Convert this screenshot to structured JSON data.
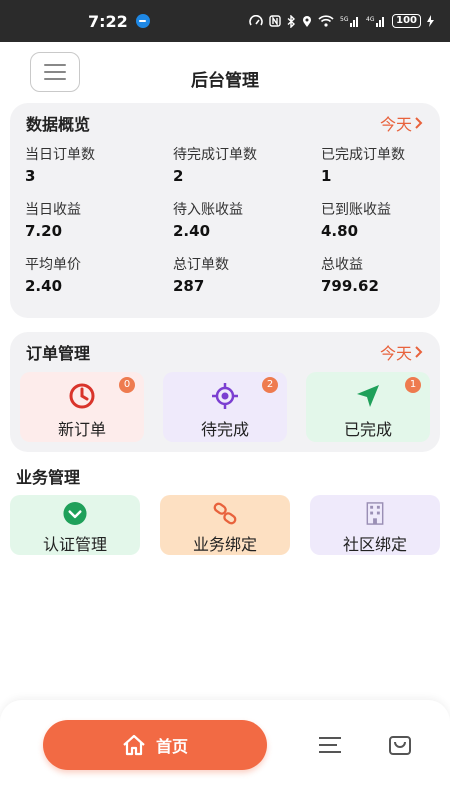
{
  "status_bar": {
    "time": "7:22",
    "battery": "100"
  },
  "header": {
    "title": "后台管理"
  },
  "overview": {
    "title": "数据概览",
    "filter_label": "今天",
    "stats": [
      {
        "label": "当日订单数",
        "value": "3"
      },
      {
        "label": "待完成订单数",
        "value": "2"
      },
      {
        "label": "已完成订单数",
        "value": "1"
      },
      {
        "label": "当日收益",
        "value": "7.20"
      },
      {
        "label": "待入账收益",
        "value": "2.40"
      },
      {
        "label": "已到账收益",
        "value": "4.80"
      },
      {
        "label": "平均单价",
        "value": "2.40"
      },
      {
        "label": "总订单数",
        "value": "287"
      },
      {
        "label": "总收益",
        "value": "799.62"
      }
    ]
  },
  "orders": {
    "title": "订单管理",
    "filter_label": "今天",
    "tiles": [
      {
        "label": "新订单",
        "badge": "0",
        "icon": "clock-icon",
        "bg": "#fdeceb",
        "icon_color": "#d9342b"
      },
      {
        "label": "待完成",
        "badge": "2",
        "icon": "target-icon",
        "bg": "#efeafb",
        "icon_color": "#7b3fd1"
      },
      {
        "label": "已完成",
        "badge": "1",
        "icon": "send-icon",
        "bg": "#e3f7ea",
        "icon_color": "#1fa05a"
      }
    ]
  },
  "business": {
    "title": "业务管理",
    "tiles": [
      {
        "label": "认证管理",
        "icon": "check-circle-icon",
        "bg": "#e3f7ea",
        "icon_color": "#1fa05a"
      },
      {
        "label": "业务绑定",
        "icon": "link-icon",
        "bg": "#fde0c2",
        "icon_color": "#e8623c"
      },
      {
        "label": "社区绑定",
        "icon": "building-icon",
        "bg": "#efeafb",
        "icon_color": "#9a8fb5"
      }
    ]
  },
  "bottom_nav": {
    "home_label": "首页",
    "accent": "#f26a44"
  }
}
